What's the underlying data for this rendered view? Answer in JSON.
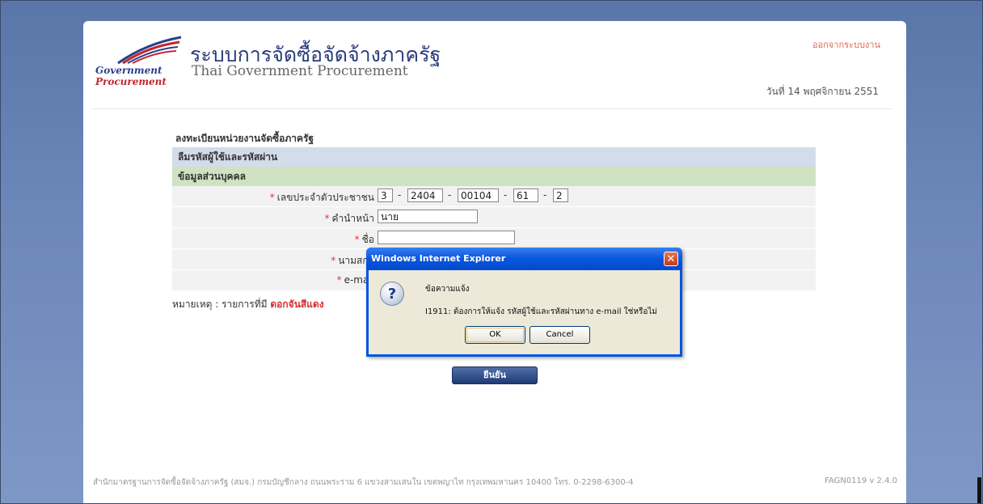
{
  "header": {
    "logo_line1": "Government",
    "logo_line2": "Procurement",
    "title_thai": "ระบบการจัดซื้อจัดจ้างภาครัฐ",
    "title_english": "Thai Government Procurement",
    "logout_link": "ออกจากระบบงาน",
    "date": "วันที่ 14 พฤศจิกายน 2551"
  },
  "form": {
    "title": "ลงทะเบียนหน่วยงานจัดซื้อภาครัฐ",
    "section_blue": "ลืมรหัสผู้ใช้และรหัสผ่าน",
    "section_green": "ข้อมูลส่วนบุคคล",
    "id_label": "เลขประจำตัวประชาชน",
    "id_parts": [
      "3",
      "2404",
      "00104",
      "61",
      "2"
    ],
    "title_label": "คำนำหน้า",
    "title_value": "นาย",
    "firstname_label": "ชื่อ",
    "lastname_label": "นามสกุล",
    "email_label": "e-mail",
    "note_prefix": "หมายเหตุ : รายการที่มี",
    "note_red": "ดอกจันสีแดง",
    "submit_label": "ยืนยัน"
  },
  "dialog": {
    "title": "Windows Internet Explorer",
    "close_glyph": "✕",
    "icon_glyph": "?",
    "message_heading": "ข้อความแจ้ง",
    "message_body": "I1911: ต้องการให้แจ้ง รหัสผู้ใช้และรหัสผ่านทาง e-mail ใช่หรือไม่",
    "ok_label": "OK",
    "cancel_label": "Cancel"
  },
  "footer": {
    "address": "สำนักมาตรฐานการจัดซื้อจัดจ้างภาครัฐ (สมจ.) กรมบัญชีกลาง ถนนพระราม 6 แขวงสามเสนใน เขตพญาไท กรุงเทพมหานคร 10400 โทร. 0-2298-6300-4",
    "version": "FAGN0119 v 2.4.0"
  },
  "colors": {
    "background": "#6b86b8",
    "title_blue": "#2a3d7c",
    "section_blue": "#d3dcea",
    "section_green": "#cfe2c2",
    "required_red": "#e33333",
    "dialog_titlebar": "#0a58e0"
  }
}
